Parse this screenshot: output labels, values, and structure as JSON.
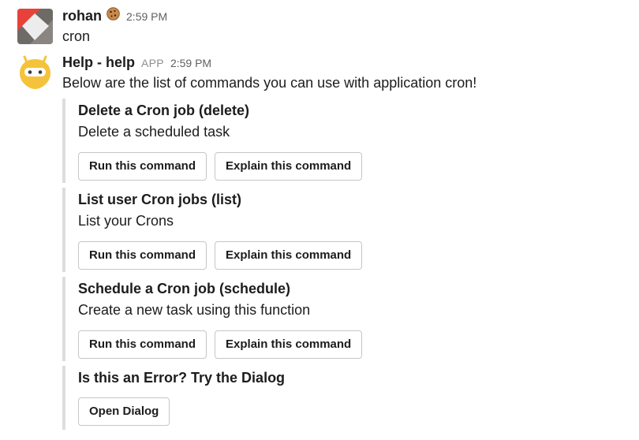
{
  "messages": [
    {
      "author": "rohan",
      "status_emoji": "cookie-emoji",
      "time": "2:59 PM",
      "text": "cron"
    },
    {
      "author": "Help - help",
      "badge": "APP",
      "time": "2:59 PM",
      "text": "Below are the list of commands you can use with application cron!"
    }
  ],
  "attachments": [
    {
      "title": "Delete a Cron job (delete)",
      "text": "Delete a scheduled task",
      "run_label": "Run this command",
      "explain_label": "Explain this command"
    },
    {
      "title": "List user Cron jobs (list)",
      "text": "List your Crons",
      "run_label": "Run this command",
      "explain_label": "Explain this command"
    },
    {
      "title": "Schedule a Cron job (schedule)",
      "text": "Create a new task using this function",
      "run_label": "Run this command",
      "explain_label": "Explain this command"
    },
    {
      "title": "Is this an Error? Try the Dialog",
      "open_label": "Open Dialog"
    }
  ],
  "colors": {
    "attachment_border": "#dddddd",
    "text": "#1d1c1d",
    "timestamp": "#616061",
    "bot_avatar": "#f5c33b",
    "user_avatar_red": "#e8413a",
    "user_avatar_gray": "#6e6a66"
  }
}
